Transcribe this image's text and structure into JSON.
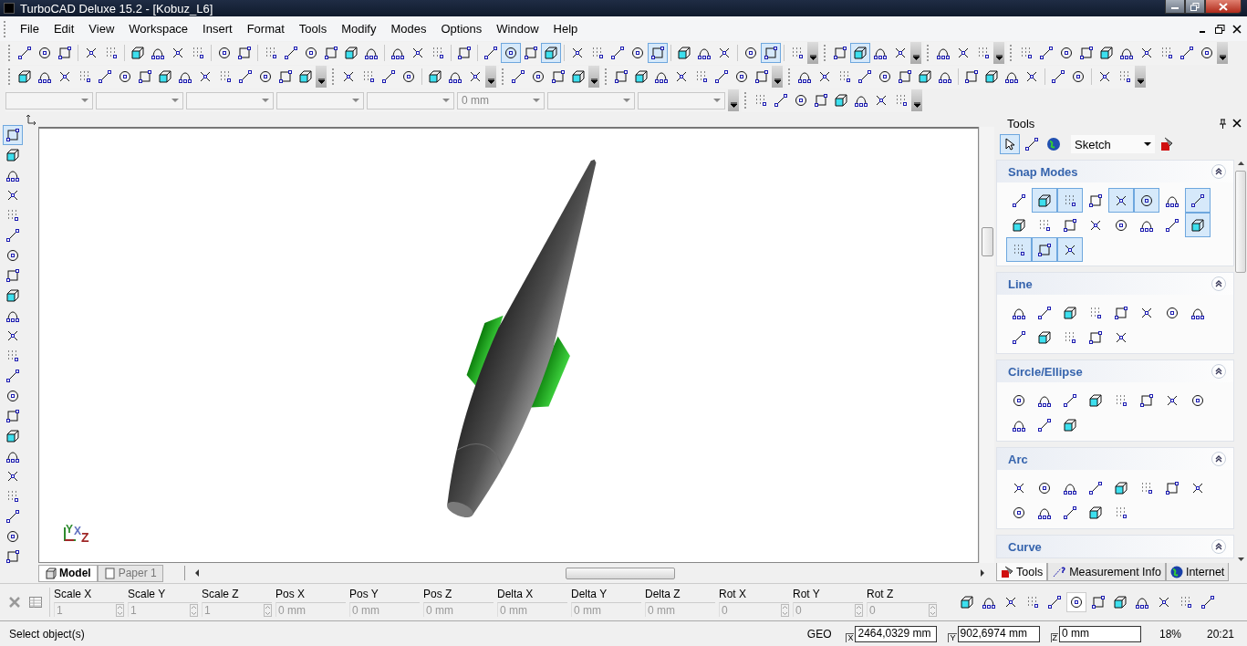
{
  "window": {
    "title": "TurboCAD Deluxe 15.2 - [Kobuz_L6]"
  },
  "menu": [
    "File",
    "Edit",
    "View",
    "Workspace",
    "Insert",
    "Format",
    "Tools",
    "Modify",
    "Modes",
    "Options",
    "Window",
    "Help"
  ],
  "toolbar_rows": [
    {
      "toolbars": [
        {
          "groups": [
            [
              {
                "pressed": false
              },
              {
                "pressed": false
              },
              {
                "pressed": false
              }
            ],
            [
              {
                "pressed": false
              },
              {
                "pressed": false
              }
            ],
            [
              {
                "pressed": false
              },
              {
                "pressed": false
              },
              {
                "pressed": false
              },
              {
                "pressed": false
              }
            ],
            [
              {
                "pressed": false
              },
              {
                "pressed": false
              }
            ],
            [
              {
                "pressed": false
              },
              {
                "pressed": false
              },
              {
                "pressed": false
              },
              {
                "pressed": false
              },
              {
                "pressed": false
              },
              {
                "pressed": false
              }
            ],
            [
              {
                "pressed": false
              },
              {
                "pressed": false
              },
              {
                "pressed": false
              }
            ],
            [
              {
                "pressed": false
              }
            ],
            [
              {
                "pressed": false
              },
              {
                "pressed": true
              },
              {
                "pressed": false
              },
              {
                "pressed": true
              }
            ],
            [
              {
                "pressed": false
              },
              {
                "pressed": false
              },
              {
                "pressed": false
              },
              {
                "pressed": false
              },
              {
                "pressed": true
              }
            ],
            [
              {
                "pressed": false
              },
              {
                "pressed": false
              },
              {
                "pressed": false
              }
            ],
            [
              {
                "pressed": false
              },
              {
                "pressed": true
              }
            ],
            [
              {
                "pressed": false
              }
            ]
          ]
        },
        {
          "groups": [
            [
              {
                "pressed": false
              },
              {
                "pressed": true
              },
              {
                "pressed": false
              },
              {
                "pressed": false
              }
            ]
          ]
        },
        {
          "groups": [
            [
              {
                "pressed": false
              },
              {
                "pressed": false
              },
              {
                "pressed": false
              }
            ]
          ]
        },
        {
          "groups": [
            [
              {
                "pressed": false
              },
              {
                "pressed": false
              },
              {
                "pressed": false
              },
              {
                "pressed": false
              },
              {
                "pressed": false
              },
              {
                "pressed": false
              },
              {
                "pressed": false
              },
              {
                "pressed": false
              },
              {
                "pressed": false
              },
              {
                "pressed": false
              }
            ]
          ]
        }
      ]
    },
    {
      "toolbars": [
        {
          "groups": [
            [
              {
                "pressed": false
              },
              {
                "pressed": false
              },
              {
                "pressed": false
              },
              {
                "pressed": false
              },
              {
                "pressed": false
              },
              {
                "pressed": false
              },
              {
                "pressed": false
              },
              {
                "pressed": false
              },
              {
                "pressed": false
              },
              {
                "pressed": false
              },
              {
                "pressed": false
              },
              {
                "pressed": false
              },
              {
                "pressed": false
              },
              {
                "pressed": false
              },
              {
                "pressed": false
              }
            ]
          ]
        },
        {
          "groups": [
            [
              {
                "pressed": false
              },
              {
                "pressed": false
              },
              {
                "pressed": false
              },
              {
                "pressed": false
              }
            ],
            [
              {
                "pressed": false
              },
              {
                "pressed": false
              },
              {
                "pressed": false
              }
            ]
          ]
        },
        {
          "groups": [
            [
              {
                "pressed": false
              },
              {
                "pressed": false
              },
              {
                "pressed": false
              },
              {
                "pressed": false
              }
            ]
          ]
        },
        {
          "groups": [
            [
              {
                "pressed": false
              },
              {
                "pressed": false
              },
              {
                "pressed": false
              },
              {
                "pressed": false
              },
              {
                "pressed": false
              },
              {
                "pressed": false
              },
              {
                "pressed": false
              },
              {
                "pressed": false
              }
            ]
          ]
        },
        {
          "groups": [
            [
              {
                "pressed": false
              },
              {
                "pressed": false
              },
              {
                "pressed": false
              },
              {
                "pressed": false
              },
              {
                "pressed": false
              },
              {
                "pressed": false
              },
              {
                "pressed": false
              },
              {
                "pressed": false
              }
            ],
            [
              {
                "pressed": false
              },
              {
                "pressed": false
              },
              {
                "pressed": false
              },
              {
                "pressed": false
              }
            ],
            [
              {
                "pressed": false
              },
              {
                "pressed": false
              }
            ],
            [
              {
                "pressed": false
              },
              {
                "pressed": false
              }
            ]
          ]
        }
      ]
    },
    {
      "toolbars": [
        {
          "groups": [
            [
              {
                "pressed": false
              },
              {
                "pressed": false
              },
              {
                "pressed": false
              },
              {
                "pressed": false
              },
              {
                "pressed": false
              },
              {
                "pressed": false
              },
              {
                "pressed": false
              },
              {
                "pressed": false
              }
            ]
          ]
        }
      ]
    }
  ],
  "property_combos": [
    {
      "kind": "empty"
    },
    {
      "kind": "empty"
    },
    {
      "kind": "empty"
    },
    {
      "kind": "empty"
    },
    {
      "kind": "empty"
    },
    {
      "kind": "value",
      "value": "0 mm"
    },
    {
      "kind": "empty"
    },
    {
      "kind": "empty"
    }
  ],
  "left_toolbar": [
    {
      "pressed": true
    },
    {
      "pressed": false
    },
    {
      "pressed": false
    },
    {
      "pressed": false
    },
    {
      "pressed": false
    },
    {
      "pressed": false
    },
    {
      "pressed": false
    },
    {
      "pressed": false
    },
    {
      "pressed": false
    },
    {
      "pressed": false
    },
    {
      "pressed": false
    },
    {
      "pressed": false
    },
    {
      "pressed": false
    },
    {
      "pressed": false
    },
    {
      "pressed": false
    },
    {
      "pressed": false
    },
    {
      "pressed": false
    },
    {
      "pressed": false
    },
    {
      "pressed": false
    },
    {
      "pressed": false
    },
    {
      "pressed": false
    },
    {
      "pressed": false
    }
  ],
  "canvas": {
    "axis_labels": [
      {
        "text": "Y",
        "color": "#2e8b2e"
      },
      {
        "text": "X",
        "color": "#6070c0"
      },
      {
        "text": "Z",
        "color": "#a02828"
      }
    ]
  },
  "sheet_tabs": [
    {
      "label": "Model",
      "selected": true
    },
    {
      "label": "Paper 1",
      "selected": false
    }
  ],
  "tools_panel": {
    "title": "Tools",
    "mode": "Sketch",
    "sections": [
      {
        "title": "Snap Modes",
        "expanded": true,
        "buttons": [
          {
            "pressed": false
          },
          {
            "pressed": true
          },
          {
            "pressed": true
          },
          {
            "pressed": false
          },
          {
            "pressed": true
          },
          {
            "pressed": true
          },
          {
            "pressed": false
          },
          {
            "pressed": true
          },
          {
            "pressed": false
          },
          {
            "pressed": false
          },
          {
            "pressed": false
          },
          {
            "pressed": false
          },
          {
            "pressed": false
          },
          {
            "pressed": false
          },
          {
            "pressed": false
          },
          {
            "pressed": true
          },
          {
            "pressed": true
          },
          {
            "pressed": true
          },
          {
            "pressed": true
          }
        ]
      },
      {
        "title": "Line",
        "expanded": true,
        "buttons": [
          {
            "pressed": false
          },
          {
            "pressed": false
          },
          {
            "pressed": false
          },
          {
            "pressed": false
          },
          {
            "pressed": false
          },
          {
            "pressed": false
          },
          {
            "pressed": false
          },
          {
            "pressed": false
          },
          {
            "pressed": false
          },
          {
            "pressed": false
          },
          {
            "pressed": false
          },
          {
            "pressed": false
          },
          {
            "pressed": false
          }
        ]
      },
      {
        "title": "Circle/Ellipse",
        "expanded": true,
        "buttons": [
          {
            "pressed": false
          },
          {
            "pressed": false
          },
          {
            "pressed": false
          },
          {
            "pressed": false
          },
          {
            "pressed": false
          },
          {
            "pressed": false
          },
          {
            "pressed": false
          },
          {
            "pressed": false
          },
          {
            "pressed": false
          },
          {
            "pressed": false
          },
          {
            "pressed": false
          }
        ]
      },
      {
        "title": "Arc",
        "expanded": true,
        "buttons": [
          {
            "pressed": false
          },
          {
            "pressed": false
          },
          {
            "pressed": false
          },
          {
            "pressed": false
          },
          {
            "pressed": false
          },
          {
            "pressed": false
          },
          {
            "pressed": false
          },
          {
            "pressed": false
          },
          {
            "pressed": false
          },
          {
            "pressed": false
          },
          {
            "pressed": false
          },
          {
            "pressed": false
          },
          {
            "pressed": false
          }
        ]
      },
      {
        "title": "Curve",
        "expanded": true
      }
    ]
  },
  "panel_tabs": [
    {
      "label": "Tools",
      "selected": true
    },
    {
      "label": "Measurement Info",
      "selected": false
    },
    {
      "label": "Internet",
      "selected": false
    }
  ],
  "inspector": {
    "fields": [
      {
        "label": "Scale X",
        "value": "1",
        "kind": "spin",
        "disabled": true
      },
      {
        "label": "Scale Y",
        "value": "1",
        "kind": "spin",
        "disabled": true
      },
      {
        "label": "Scale Z",
        "value": "1",
        "kind": "spin",
        "disabled": true
      },
      {
        "label": "Pos X",
        "value": "0 mm",
        "kind": "text",
        "disabled": true
      },
      {
        "label": "Pos Y",
        "value": "0 mm",
        "kind": "text",
        "disabled": true
      },
      {
        "label": "Pos Z",
        "value": "0 mm",
        "kind": "text",
        "disabled": true
      },
      {
        "label": "Delta X",
        "value": "0 mm",
        "kind": "text",
        "disabled": true
      },
      {
        "label": "Delta Y",
        "value": "0 mm",
        "kind": "text",
        "disabled": true
      },
      {
        "label": "Delta Z",
        "value": "0 mm",
        "kind": "text",
        "disabled": true
      },
      {
        "label": "Rot X",
        "value": "0",
        "kind": "spin",
        "disabled": true
      },
      {
        "label": "Rot Y",
        "value": "0",
        "kind": "spin",
        "disabled": true
      },
      {
        "label": "Rot Z",
        "value": "0",
        "kind": "spin",
        "disabled": true
      }
    ],
    "buttons": [
      {
        "pressed": false
      },
      {
        "pressed": false
      },
      {
        "pressed": false
      },
      {
        "pressed": false
      },
      {
        "pressed": false
      },
      {
        "pressed": true
      },
      {
        "pressed": false
      },
      {
        "pressed": false
      },
      {
        "pressed": false
      },
      {
        "pressed": false
      },
      {
        "pressed": false
      },
      {
        "pressed": false
      }
    ]
  },
  "status_bar": {
    "message": "Select object(s)",
    "mode": "GEO",
    "coordinates": [
      {
        "axis": "X",
        "value": "2464,0329 mm"
      },
      {
        "axis": "Y",
        "value": "902,6974 mm"
      },
      {
        "axis": "Z",
        "value": "0 mm"
      }
    ],
    "zoom": "18%",
    "time": "20:21"
  }
}
